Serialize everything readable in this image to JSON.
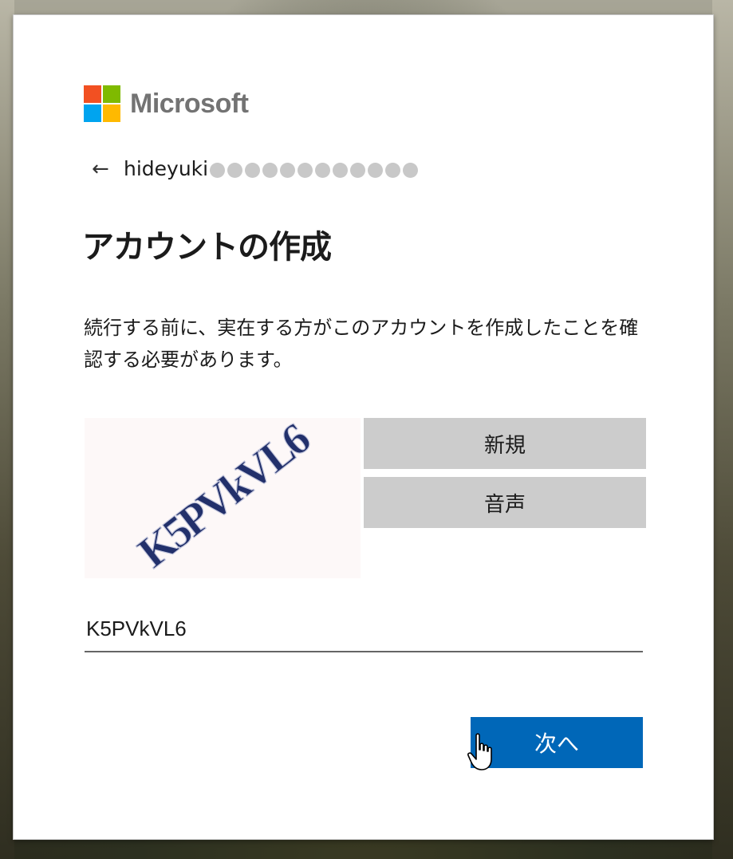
{
  "brand": {
    "name": "Microsoft",
    "colors": [
      "#f25022",
      "#7fba00",
      "#00a4ef",
      "#ffb900"
    ]
  },
  "back": {
    "icon": "back-arrow-icon",
    "arrow_glyph": "←"
  },
  "identity": {
    "username_visible": "hideyuki",
    "masked_dot_count": 12
  },
  "page": {
    "title": "アカウントの作成",
    "description": "続行する前に、実在する方がこのアカウントを作成したことを確認する必要があります。"
  },
  "captcha": {
    "image_text": "K5PVkVL6",
    "new_button": "新規",
    "audio_button": "音声",
    "input_value": "K5PVkVL6"
  },
  "actions": {
    "next_button": "次へ",
    "accent_color": "#0067b8"
  }
}
